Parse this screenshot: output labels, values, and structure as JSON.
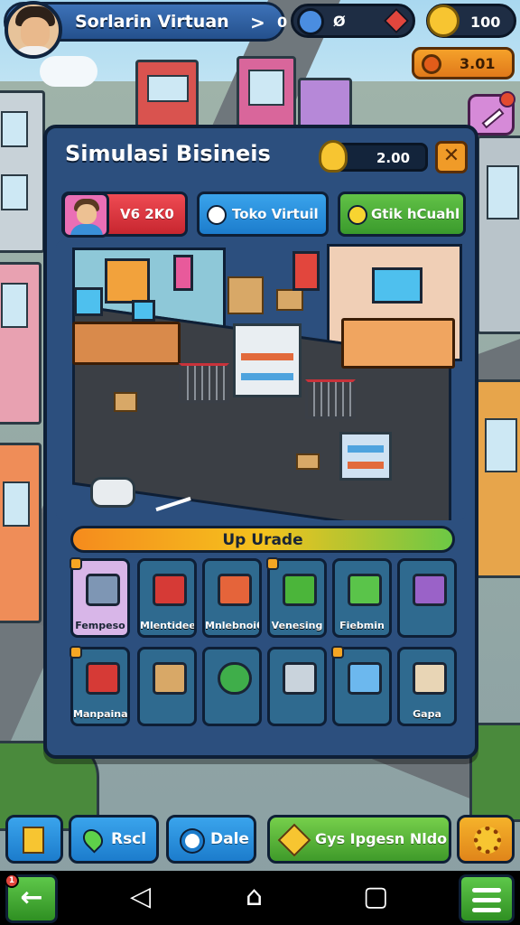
{
  "hud": {
    "player_name": "Sorlarin Virtuan",
    "arrow": ">",
    "counter": "0",
    "gem_value": "Ø",
    "coins": "100",
    "cash": "3.01"
  },
  "panel": {
    "title": "Simulasi Bisineis",
    "coin_value": "2.00",
    "close_glyph": "✕",
    "tabs": [
      {
        "label": "V6 2K0"
      },
      {
        "label": "Toko Virtuil"
      },
      {
        "label": "Gtik hCuahl"
      }
    ],
    "upgrade_label": "Up Urade",
    "slots_row1": [
      {
        "label": "Fempeso",
        "icon": "cash-register-icon"
      },
      {
        "label": "Mlentidee",
        "icon": "red-crate-icon"
      },
      {
        "label": "Mnlebnoi6",
        "icon": "gift-box-icon"
      },
      {
        "label": "Venesing",
        "icon": "green-box-icon"
      },
      {
        "label": "Fiebmin",
        "icon": "green-cube-icon"
      },
      {
        "label": "",
        "icon": "shopping-cart-icon"
      }
    ],
    "slots_row2": [
      {
        "label": "Manpaina",
        "icon": "basket-icon"
      },
      {
        "label": "",
        "icon": "cardboard-box-icon"
      },
      {
        "label": "",
        "icon": "green-robot-icon"
      },
      {
        "label": "",
        "icon": "basket-icon"
      },
      {
        "label": "",
        "icon": "fridge-icon"
      },
      {
        "label": "Gapa",
        "icon": "box-stack-icon"
      }
    ]
  },
  "actions": {
    "rset": "Rscl",
    "dale": "Dale",
    "quest": "Gys Ipgesn Nldo"
  },
  "nav": {
    "back_badge": "1",
    "back_glyph": "←",
    "sys_back": "◁",
    "sys_home": "⌂",
    "sys_recent": "▢"
  },
  "colors": {
    "panel_bg": "#2c4f7e",
    "accent_orange": "#f09b28",
    "accent_green": "#62c247",
    "accent_blue": "#3aa4ec",
    "accent_red": "#ef4b53"
  }
}
